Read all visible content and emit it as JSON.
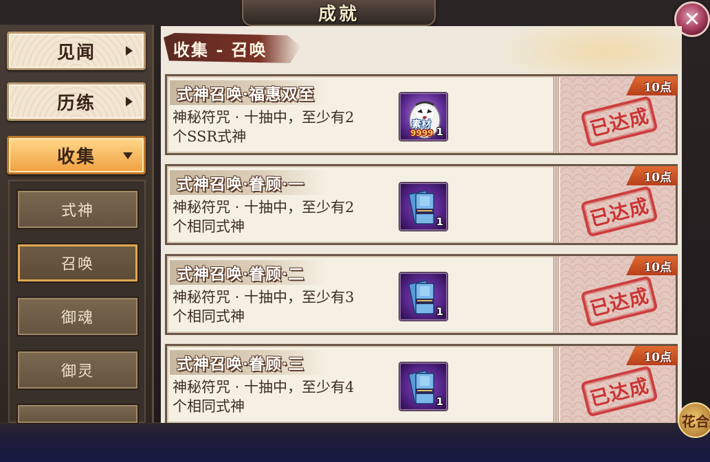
{
  "window": {
    "title": "成就"
  },
  "close_glyph": "✕",
  "sidebar": {
    "top_items": [
      {
        "label": "见闻",
        "state": "collapsed"
      },
      {
        "label": "历练",
        "state": "collapsed"
      },
      {
        "label": "收集",
        "state": "expanded"
      }
    ],
    "sub_items": [
      {
        "label": "式神"
      },
      {
        "label": "召唤",
        "selected": true
      },
      {
        "label": "御魂"
      },
      {
        "label": "御灵"
      }
    ]
  },
  "section": {
    "title": "收集 - 召唤"
  },
  "achievements": [
    {
      "title": "式神召唤·福惠双至",
      "desc_line1": "神秘符咒 · 十抽中，至少有2",
      "desc_line2": "个SSR式神",
      "reward": {
        "icon": "daruma-material-icon",
        "label": "素材",
        "sub": "9999",
        "count": "1"
      },
      "points": "10点",
      "status": "已达成"
    },
    {
      "title": "式神召唤·眷顾·一",
      "desc_line1": "神秘符咒 · 十抽中，至少有2",
      "desc_line2": "个相同式神",
      "reward": {
        "icon": "mystery-amulet-icon",
        "count": "1"
      },
      "points": "10点",
      "status": "已达成"
    },
    {
      "title": "式神召唤·眷顾·二",
      "desc_line1": "神秘符咒 · 十抽中，至少有3",
      "desc_line2": "个相同式神",
      "reward": {
        "icon": "mystery-amulet-icon",
        "count": "1"
      },
      "points": "10点",
      "status": "已达成"
    },
    {
      "title": "式神召唤·眷顾·三",
      "desc_line1": "神秘符咒 · 十抽中，至少有4",
      "desc_line2": "个相同式神",
      "reward": {
        "icon": "mystery-amulet-icon",
        "count": "1"
      },
      "points": "10点",
      "status": "已达成"
    }
  ],
  "emblem": {
    "label": "花合"
  },
  "colors": {
    "accent": "#f0a040",
    "stamp_red": "#c82424",
    "points_orange": "#d05826",
    "item_purple": "#6a2eaa"
  }
}
